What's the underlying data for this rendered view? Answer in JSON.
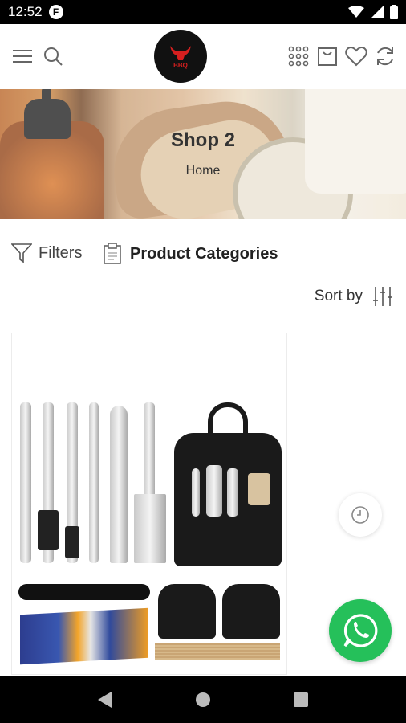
{
  "status_bar": {
    "time": "12:52",
    "app_badge": "F"
  },
  "header": {
    "menu_icon": "menu-icon",
    "search_icon": "search-icon",
    "logo_text": "BBQ",
    "grid_icon": "grid-icon",
    "cart_icon": "cart-icon",
    "wishlist_icon": "heart-icon",
    "compare_icon": "refresh-icon"
  },
  "banner": {
    "title": "Shop 2",
    "breadcrumb": "Home"
  },
  "toolbar": {
    "filters_label": "Filters",
    "categories_label": "Product Categories",
    "sort_label": "Sort by"
  },
  "colors": {
    "whatsapp": "#25c05a",
    "logo_red": "#d61f1f"
  }
}
